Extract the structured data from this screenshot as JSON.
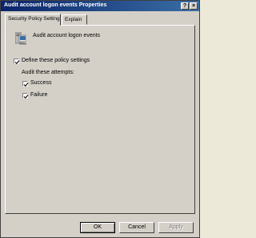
{
  "window": {
    "title": "Audit account logon events Properties",
    "help_label": "?",
    "close_label": "×"
  },
  "tabs": [
    {
      "label": "Security Policy Setting",
      "active": true
    },
    {
      "label": "Explain",
      "active": false
    }
  ],
  "policy": {
    "icon": "policy-computer-icon",
    "title": "Audit account logon events",
    "define_label": "Define these policy settings",
    "define_checked": true,
    "attempts_label": "Audit these attempts:",
    "success_label": "Success",
    "success_checked": true,
    "failure_label": "Failure",
    "failure_checked": true
  },
  "buttons": {
    "ok": "OK",
    "cancel": "Cancel",
    "apply": "Apply"
  },
  "colors": {
    "titlebar_start": "#0a246a",
    "titlebar_end": "#3a6ea5",
    "face": "#d4d0c8"
  }
}
